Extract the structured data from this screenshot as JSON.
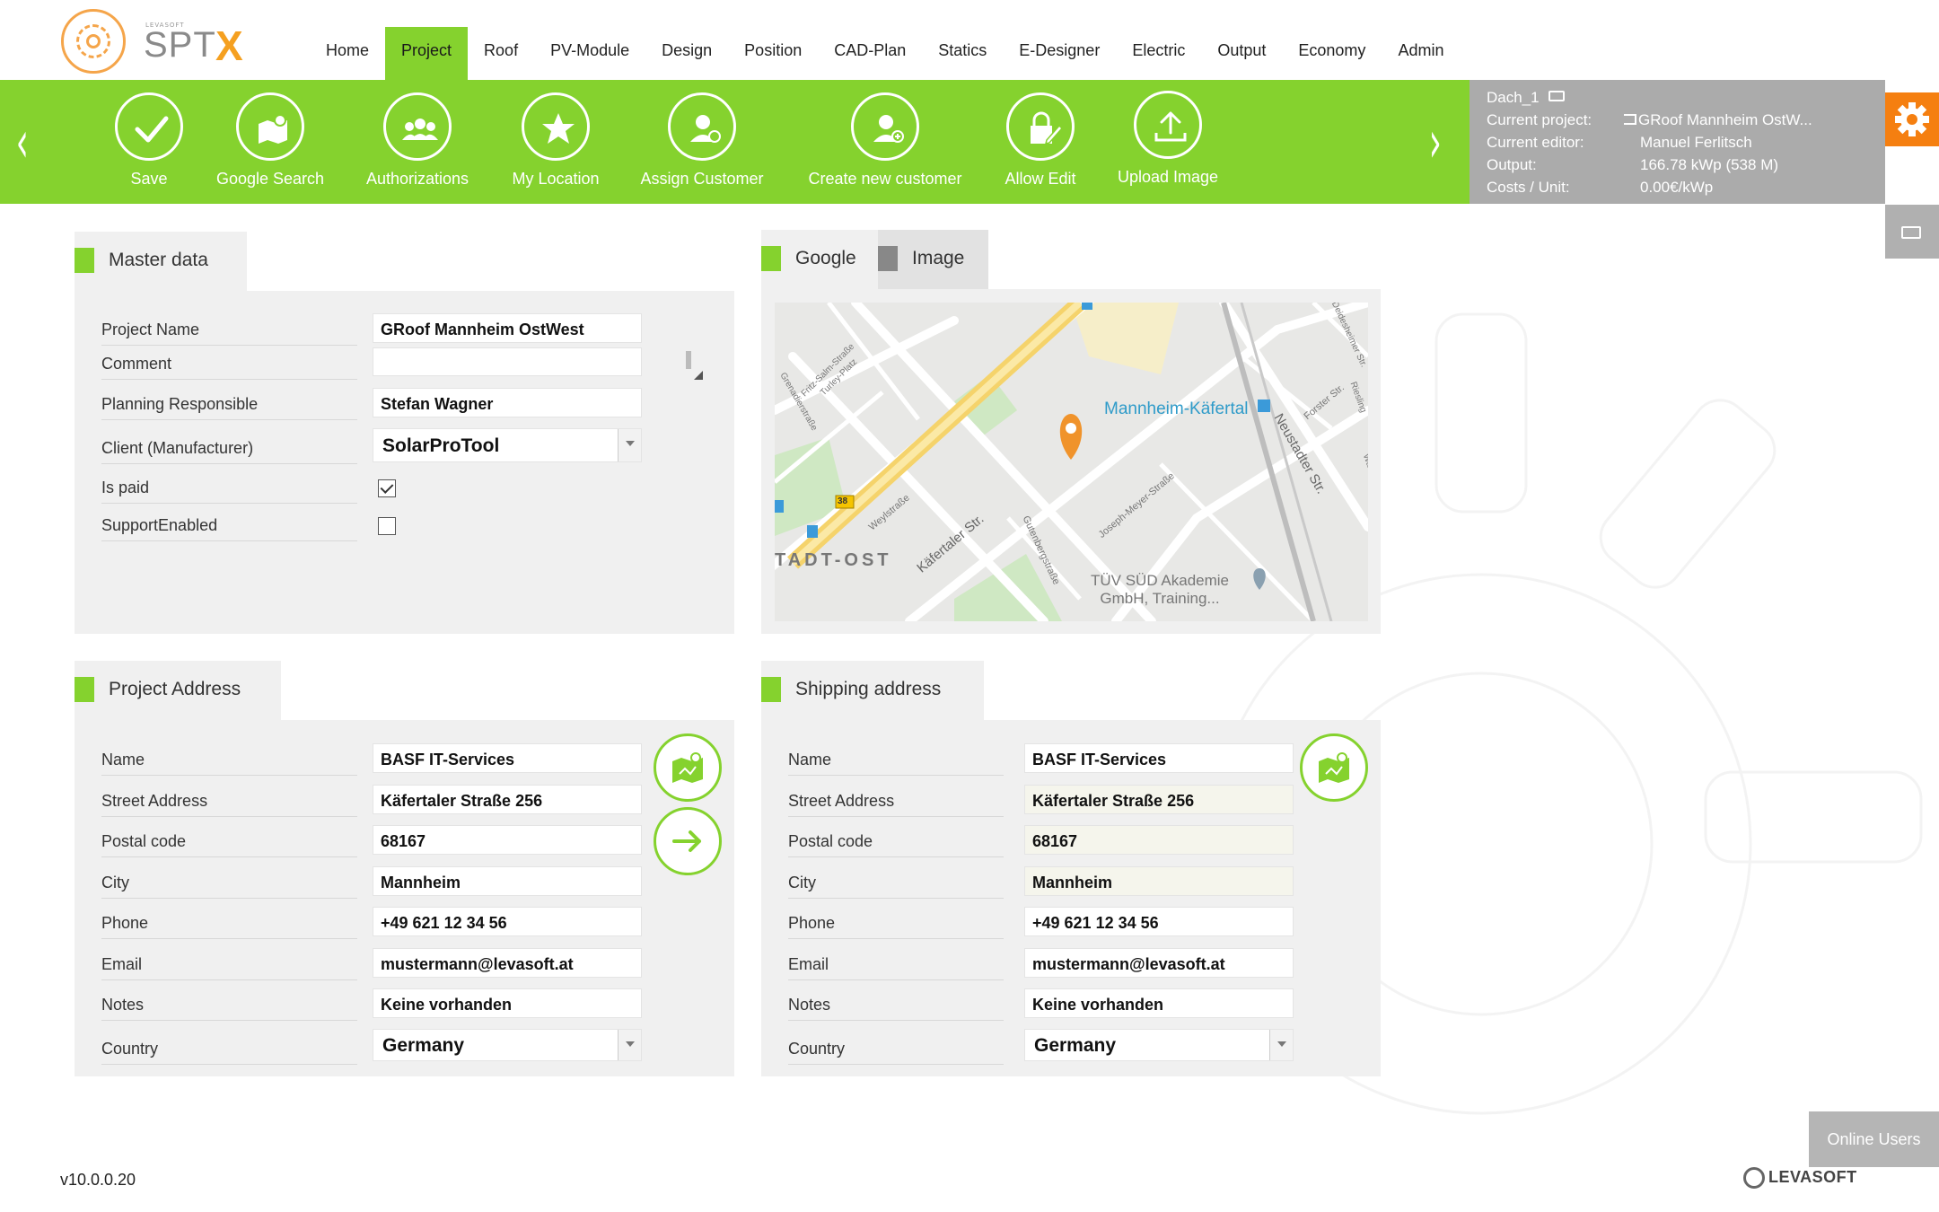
{
  "brand": {
    "small": "LEVASOFT",
    "name": "SPT",
    "x": "X"
  },
  "nav": {
    "items": [
      "Home",
      "Project",
      "Roof",
      "PV-Module",
      "Design",
      "Position",
      "CAD-Plan",
      "Statics",
      "E-Designer",
      "Electric",
      "Output",
      "Economy",
      "Admin"
    ],
    "active": "Project"
  },
  "toolbar": {
    "prev_label": "‹",
    "next_label": "›",
    "save": "Save",
    "google_search": "Google Search",
    "authorizations": "Authorizations",
    "my_location": "My Location",
    "assign_customer": "Assign Customer",
    "create_customer": "Create new customer",
    "allow_edit": "Allow Edit",
    "upload_image": "Upload Image"
  },
  "info": {
    "roof": "Dach_1",
    "project_label": "Current project:",
    "project_value": "GRoof Mannheim OstW...",
    "editor_label": "Current editor:",
    "editor_value": "Manuel Ferlitsch",
    "output_label": "Output:",
    "output_value": "166.78 kWp (538 M)",
    "costs_label": "Costs / Unit:",
    "costs_value": "0.00€/kWp"
  },
  "master": {
    "title": "Master data",
    "project_name_label": "Project Name",
    "project_name": "GRoof Mannheim OstWest",
    "comment_label": "Comment",
    "comment": "",
    "planning_label": "Planning Responsible",
    "planning": "Stefan Wagner",
    "client_label": "Client (Manufacturer)",
    "client": "SolarProTool",
    "is_paid_label": "Is paid",
    "is_paid": true,
    "support_label": "SupportEnabled",
    "support": false
  },
  "map_panel": {
    "tab_google": "Google",
    "tab_image": "Image",
    "labels": {
      "station": "Mannheim-Käfertal",
      "district": "TADT-OST",
      "street1": "Käfertaler Str.",
      "street2": "Neustadter Str.",
      "street3": "Gutenbergstraße",
      "street4": "Joseph-Meyer-Straße",
      "street5": "Weylstraße",
      "street6": "Forster Str.",
      "street7": "Fritz-Salm-Straße",
      "street8": "Turley-Platz",
      "street9": "Riesling",
      "street10": "Deidesheimer Str.",
      "street11": "Wachenheimer",
      "street12": "Grenadierstraße",
      "poi": "TÜV SÜD Akademie\nGmbH, Training...",
      "poi_line1": "TÜV SÜD Akademie",
      "poi_line2": "GmbH, Training...",
      "road_number": "38"
    }
  },
  "project_address": {
    "title": "Project Address",
    "name_label": "Name",
    "name": "BASF IT-Services",
    "street_label": "Street Address",
    "street": "Käfertaler Straße 256",
    "postal_label": "Postal code",
    "postal": "68167",
    "city_label": "City",
    "city": "Mannheim",
    "phone_label": "Phone",
    "phone": "+49 621 12 34 56",
    "email_label": "Email",
    "email": "mustermann@levasoft.at",
    "notes_label": "Notes",
    "notes": "Keine vorhanden",
    "country_label": "Country",
    "country": "Germany"
  },
  "shipping_address": {
    "title": "Shipping address",
    "name_label": "Name",
    "name": "BASF IT-Services",
    "street_label": "Street Address",
    "street": "Käfertaler Straße 256",
    "postal_label": "Postal code",
    "postal": "68167",
    "city_label": "City",
    "city": "Mannheim",
    "phone_label": "Phone",
    "phone": "+49 621 12 34 56",
    "email_label": "Email",
    "email": "mustermann@levasoft.at",
    "notes_label": "Notes",
    "notes": "Keine vorhanden",
    "country_label": "Country",
    "country": "Germany"
  },
  "footer": {
    "version": "v10.0.0.20",
    "online_users": "Online Users",
    "company": "LEVASOFT"
  },
  "colors": {
    "accent": "#85d22e",
    "orange": "#f57f10",
    "info_bg": "#ababab",
    "panel_bg": "#f0f0f0"
  }
}
